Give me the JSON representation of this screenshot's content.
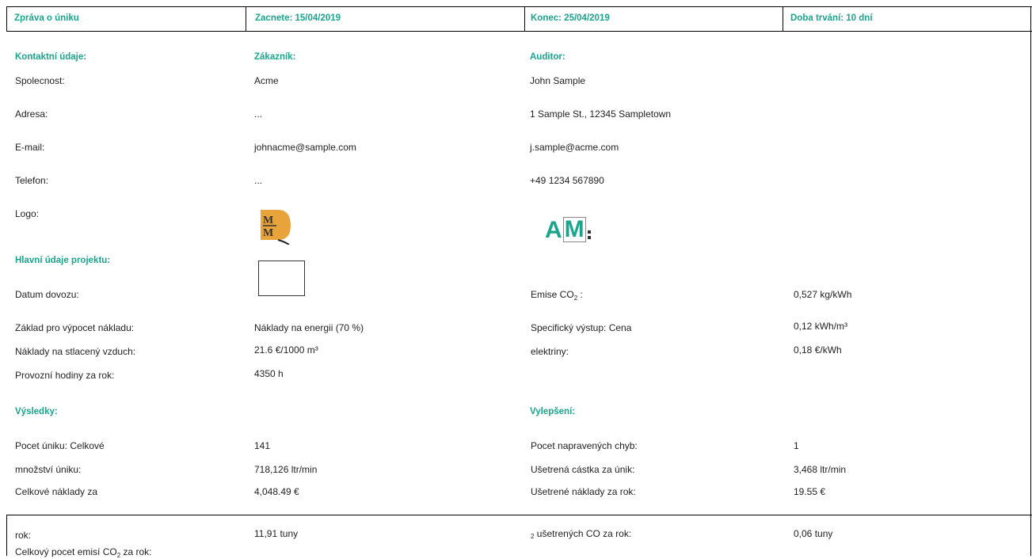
{
  "header": {
    "report_title": "Zpráva o úniku",
    "start": "Zacnete: 15/04/2019",
    "end": "Konec: 25/04/2019",
    "duration": "Doba trvání: 10 dní"
  },
  "contacts": {
    "heading": "Kontaktní údaje:",
    "customer_heading": "Zákazník:",
    "auditor_heading": "Auditor:",
    "rows": [
      {
        "label": "Spolecnost:",
        "customer": "Acme",
        "auditor": "John Sample"
      },
      {
        "label": "Adresa:",
        "customer": "...",
        "auditor": "1 Sample St., 12345 Sampletown"
      },
      {
        "label": "E-mail:",
        "customer": "johnacme@sample.com",
        "auditor": "j.sample@acme.com"
      },
      {
        "label": "Telefon:",
        "customer": "...",
        "auditor": "+49 1234 567890"
      },
      {
        "label": "Logo:",
        "customer": "",
        "auditor": ""
      }
    ],
    "customer_logo_text": "MM",
    "auditor_logo_text": {
      "a": "A",
      "m": "M"
    }
  },
  "project": {
    "heading": "Hlavní údaje projektu:",
    "import_date_label": "Datum dovozu:",
    "co2_label": "Emise CO",
    "co2_sub": "2",
    "co2_suffix": " :",
    "co2_value": "0,527 kg/kWh",
    "cost_basis_label": "Základ pro výpocet nákladu:",
    "cost_basis_value": "Náklady na energii (70 %)",
    "specific_output_label": "Specifický výstup: Cena",
    "specific_output_value": "0,12 kWh/m³",
    "air_cost_label": "Náklady na stlacený vzduch:",
    "air_cost_value": "21.6 €/1000 m³",
    "electricity_label": "elektriny:",
    "electricity_value": "0,18 €/kWh",
    "hours_label": "Provozní hodiny za rok:",
    "hours_value": "4350 h"
  },
  "results": {
    "heading": "Výsledky:",
    "improvements_heading": "Vylepšení:",
    "leak_count_label": "Pocet úniku: Celkové",
    "leak_count_value": "141",
    "leak_amount_label": "množství úniku:",
    "leak_amount_value": "718,126 ltr/min",
    "total_cost_label": "Celkové náklady za",
    "total_cost_value": "4,048.49 €",
    "fixed_label": "Pocet napravených chyb:",
    "fixed_value": "1",
    "saved_amount_label": "Ušetrená cástka za únik:",
    "saved_amount_value": "3,468 ltr/min",
    "saved_cost_label": "Ušetrené náklady za rok:",
    "saved_cost_value": "19.55 €",
    "year_label": "rok:",
    "emissions_value": "11,91 tuny",
    "saved_co2_sub": "2",
    "saved_co2_label": " ušetrených CO za rok:",
    "saved_co2_value": "0,06 tuny",
    "total_emissions_label": "Celkový pocet emisí CO",
    "total_emissions_sub": "2",
    "total_emissions_suffix": " za rok:"
  },
  "colors": {
    "accent": "#1aa58c",
    "border": "#000000"
  }
}
